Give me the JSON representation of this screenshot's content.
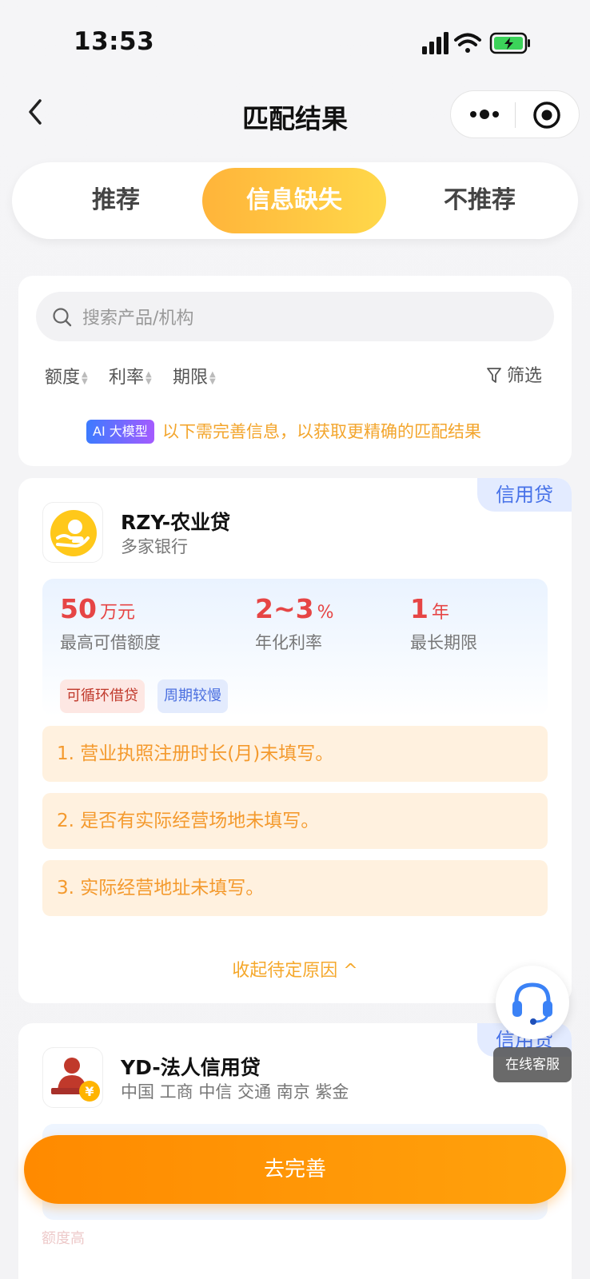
{
  "status_bar": {
    "time": "13:53"
  },
  "nav": {
    "title": "匹配结果"
  },
  "tabs": [
    {
      "label": "推荐"
    },
    {
      "label": "信息缺失"
    },
    {
      "label": "不推荐"
    }
  ],
  "search": {
    "placeholder": "搜索产品/机构"
  },
  "sort": {
    "amount": "额度",
    "rate": "利率",
    "term": "期限",
    "filter": "筛选"
  },
  "ai": {
    "badge": "AI 大模型",
    "note": "以下需完善信息，以获取更精确的匹配结果"
  },
  "products": [
    {
      "type": "信用贷",
      "name": "RZY-农业贷",
      "institution": "多家银行",
      "stats": {
        "amount_value": "50",
        "amount_unit": "万元",
        "amount_label": "最高可借额度",
        "rate_value": "2~3",
        "rate_unit": "%",
        "rate_label": "年化利率",
        "term_value": "1",
        "term_unit": "年",
        "term_label": "最长期限"
      },
      "chips": [
        "可循环借贷",
        "周期较慢"
      ],
      "reasons": [
        "1. 营业执照注册时长(月)未填写。",
        "2. 是否有实际经营场地未填写。",
        "3. 实际经营地址未填写。"
      ],
      "collapse_label": "收起待定原因 ^"
    },
    {
      "type": "信用贷",
      "name": "YD-法人信用贷",
      "institution": "中国 工商 中信 交通 南京 紫金",
      "chip_partial": "额度高"
    }
  ],
  "service": {
    "label": "在线客服"
  },
  "cta": {
    "label": "去完善"
  },
  "colors": {
    "accent": "#ff8a00",
    "tab_active": "#ffc23f",
    "stat_red": "#e64545",
    "reason_text": "#f49a2e"
  }
}
